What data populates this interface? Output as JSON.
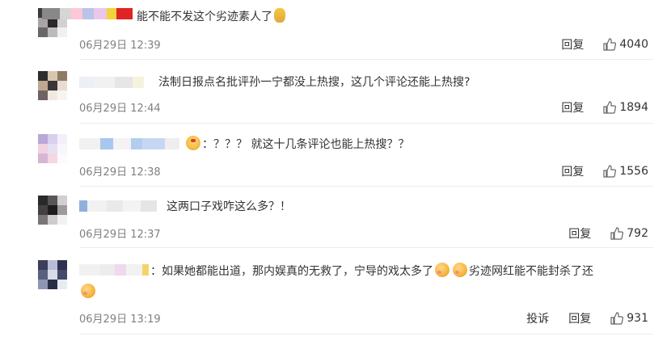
{
  "comments": [
    {
      "text": "能不能不发这个劣迹素人了",
      "time": "06月29日 12:39",
      "reply_label": "回复",
      "likes": "4040"
    },
    {
      "text": "法制日报点名批评孙一宁都没上热搜，这几个评论还能上热搜?",
      "time": "06月29日 12:44",
      "reply_label": "回复",
      "likes": "1894"
    },
    {
      "separator": "：",
      "text": "？？？ 就这十几条评论也能上热搜？？",
      "time": "06月29日 12:38",
      "reply_label": "回复",
      "likes": "1556"
    },
    {
      "text": "这两口子戏咋这么多？！",
      "time": "06月29日 12:37",
      "reply_label": "回复",
      "likes": "792"
    },
    {
      "separator": "：",
      "text_a": "如果她都能出道，那内娱真的无救了，宁导的戏太多了",
      "text_b": "劣迹网红能不能封杀了还",
      "time": "06月29日 13:19",
      "report_label": "投诉",
      "reply_label": "回复",
      "likes": "931"
    }
  ],
  "colors": {
    "username": "#eb7350",
    "meta": "#808080",
    "divider": "#ececec"
  },
  "icons": {
    "like": "thumbs-up-icon",
    "emoji_blush": "blush-emoji-icon",
    "emoji_wow": "surprised-crown-emoji-icon",
    "emoji_sad": "doge-emoji-icon"
  }
}
